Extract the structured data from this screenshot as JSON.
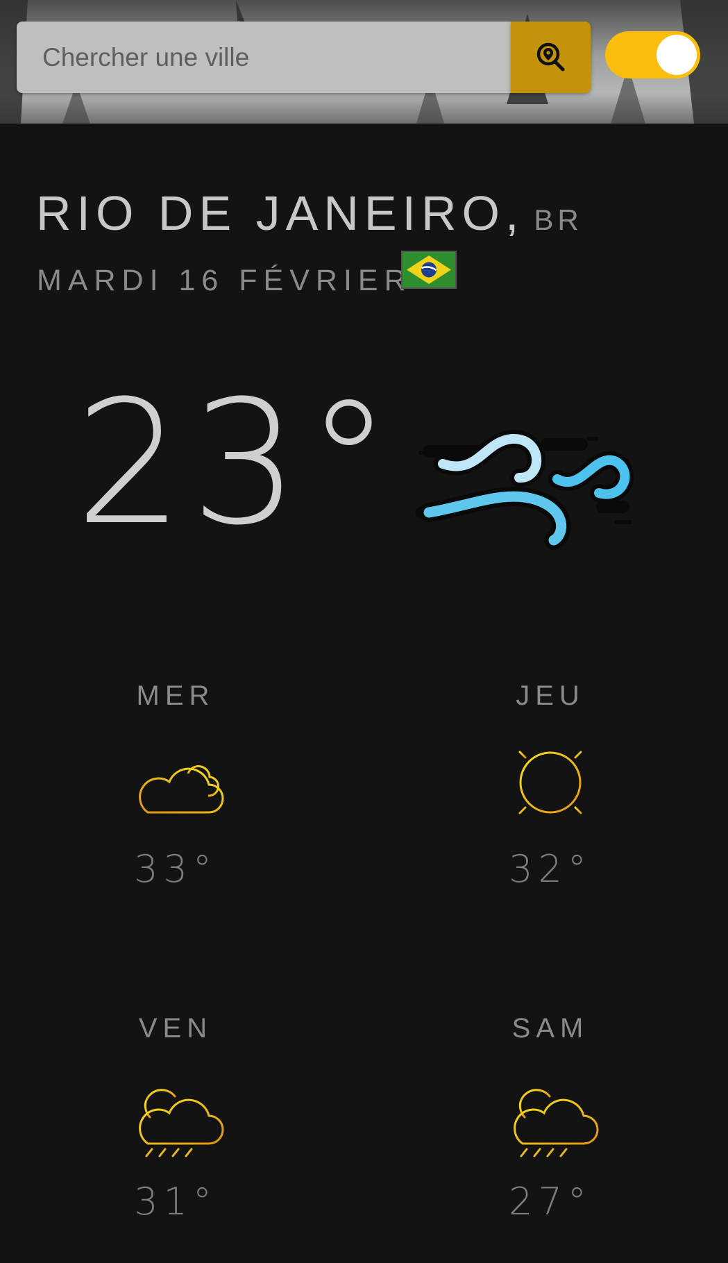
{
  "search": {
    "placeholder": "Chercher une ville",
    "button_icon": "map-search-icon"
  },
  "theme_toggle": {
    "state": "on",
    "color": "#fbbd0e"
  },
  "location": {
    "city": "RIO DE JANEIRO,",
    "country": "BR",
    "date": "MARDI 16 FÉVRIER",
    "flag_icon": "brazil-flag-icon"
  },
  "current": {
    "temperature": "23°",
    "icon": "wind-icon"
  },
  "forecast": [
    {
      "day": "MER",
      "temp": "33°",
      "icon": "partly-cloudy-icon"
    },
    {
      "day": "JEU",
      "temp": "32°",
      "icon": "sun-icon"
    },
    {
      "day": "VEN",
      "temp": "31°",
      "icon": "sun-cloud-rain-icon"
    },
    {
      "day": "SAM",
      "temp": "27°",
      "icon": "sun-cloud-rain-icon"
    }
  ],
  "colors": {
    "background": "#131313",
    "accent": "#c5930b",
    "toggle": "#fbbd0e"
  }
}
